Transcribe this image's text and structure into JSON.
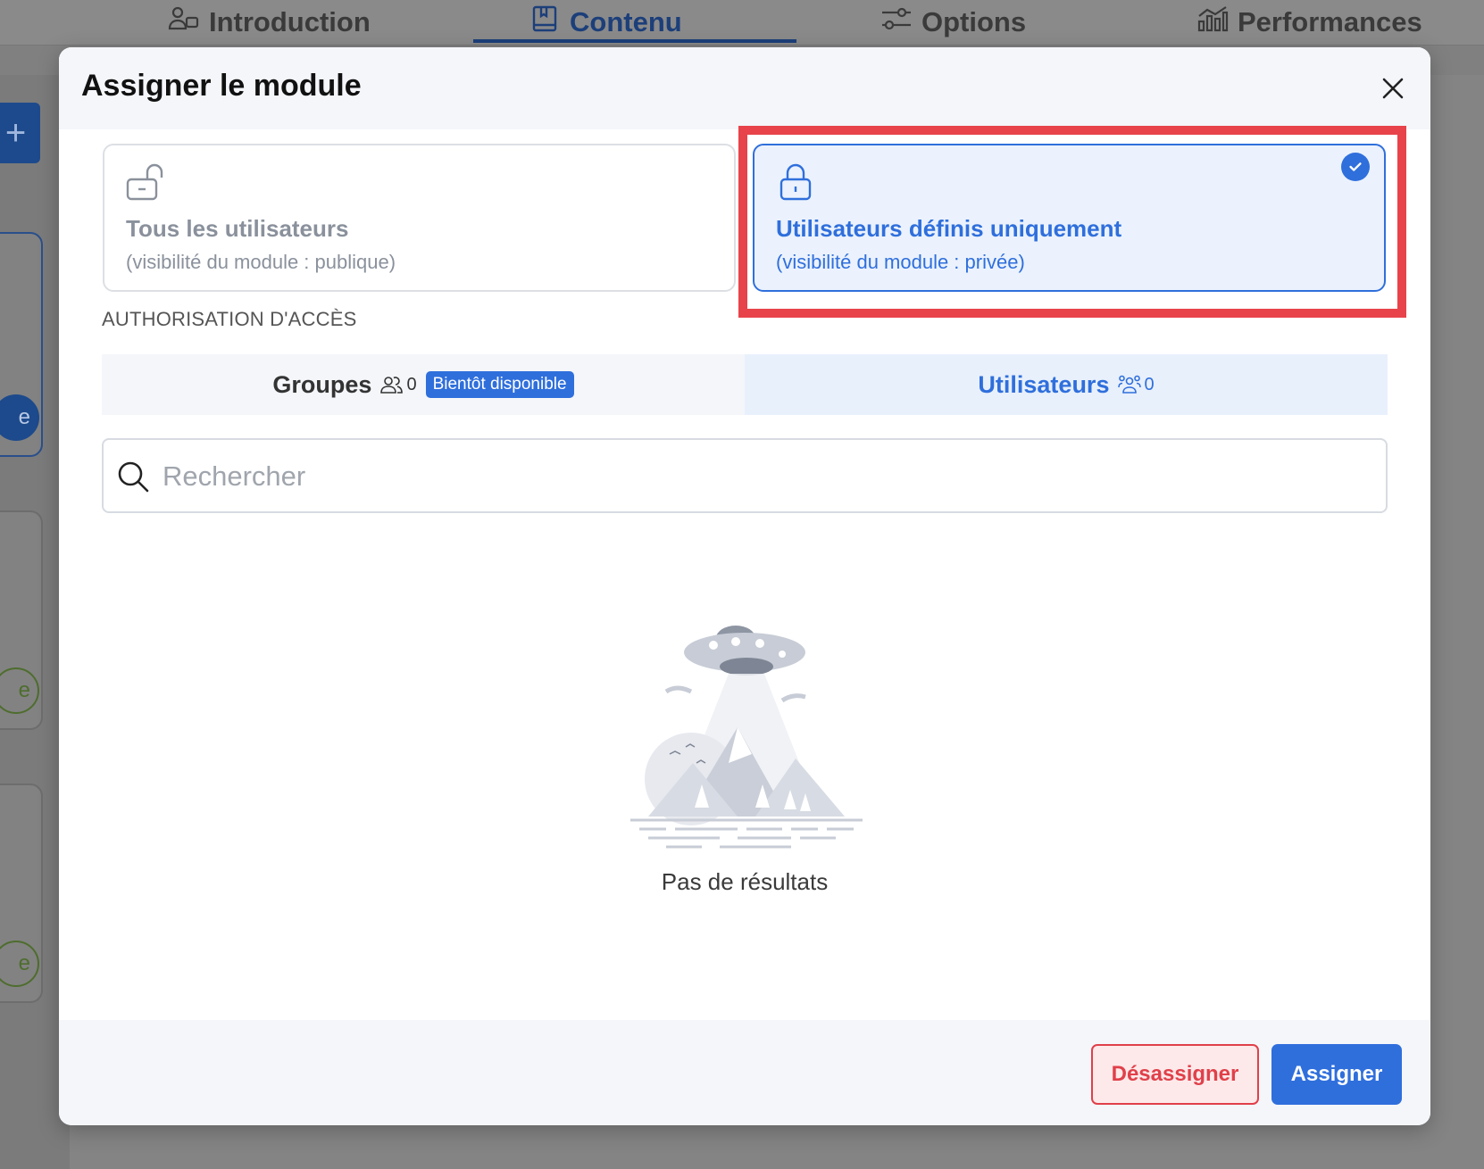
{
  "top_tabs": [
    {
      "label": "Introduction",
      "icon": "user-card-icon"
    },
    {
      "label": "Contenu",
      "icon": "book-icon"
    },
    {
      "label": "Options",
      "icon": "sliders-icon"
    },
    {
      "label": "Performances",
      "icon": "bar-chart-icon"
    }
  ],
  "modal": {
    "title": "Assigner le module",
    "options": {
      "public": {
        "title": "Tous les utilisateurs",
        "subtitle": "(visibilité du module : publique)",
        "icon": "unlocked-padlock-icon"
      },
      "private": {
        "title": "Utilisateurs définis uniquement",
        "subtitle": "(visibilité du module : privée)",
        "icon": "locked-padlock-icon",
        "selected": true
      }
    },
    "access_label": "AUTHORISATION D'ACCÈS",
    "tabs": {
      "groups": {
        "label": "Groupes",
        "count": "0",
        "badge": "Bientôt disponible"
      },
      "users": {
        "label": "Utilisateurs",
        "count": "0"
      }
    },
    "search": {
      "placeholder": "Rechercher",
      "value": ""
    },
    "empty_text": "Pas de résultats",
    "buttons": {
      "unassign": "Désassigner",
      "assign": "Assigner"
    }
  },
  "colors": {
    "accent": "#2f6fdc",
    "danger": "#e0404a",
    "highlight": "#e8434a"
  }
}
